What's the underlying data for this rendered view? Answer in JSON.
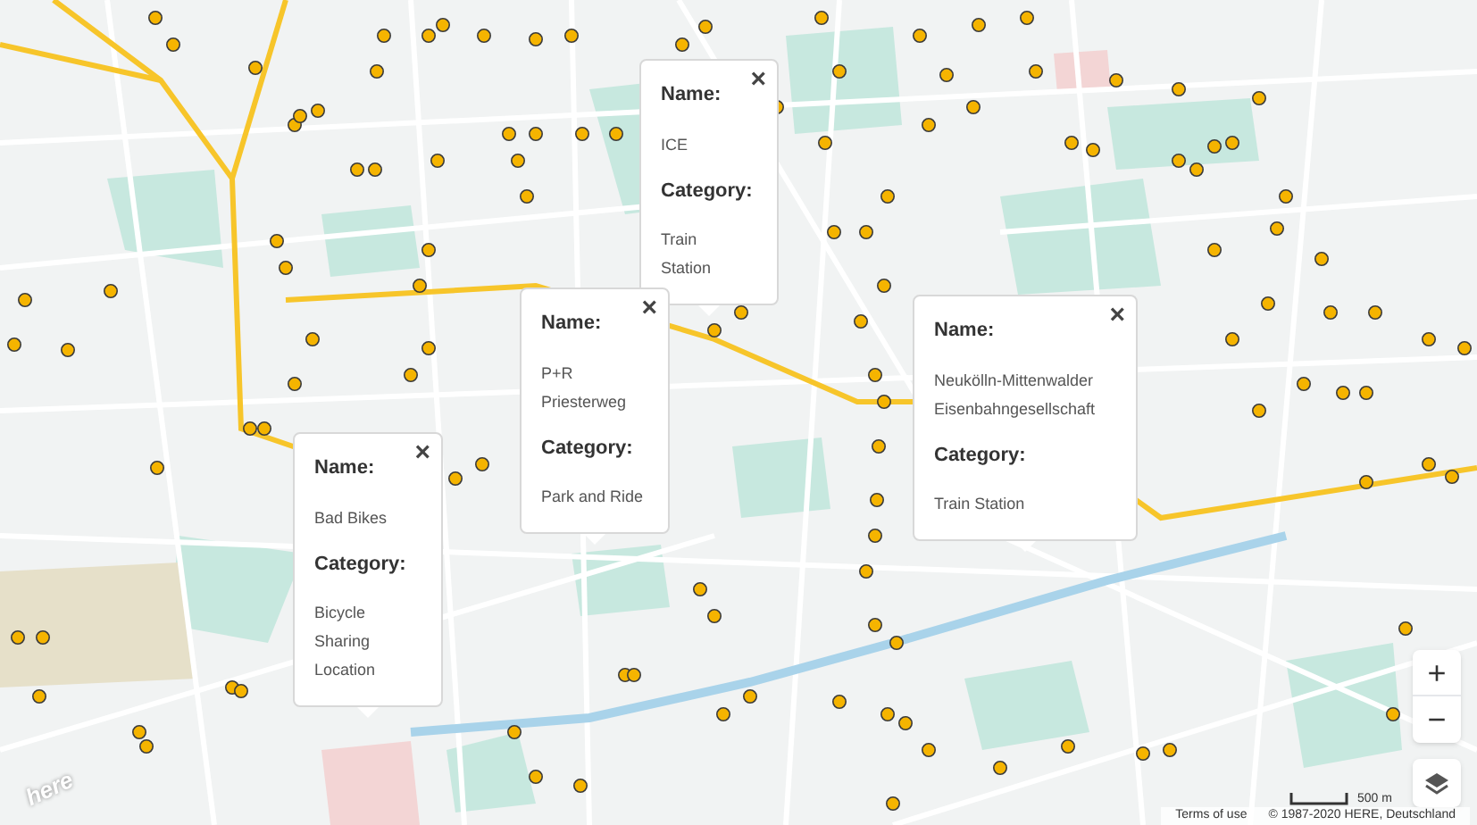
{
  "popups": [
    {
      "name_label": "Name:",
      "name": "ICE",
      "category_label": "Category:",
      "category": "Train Station",
      "close": "×"
    },
    {
      "name_label": "Name:",
      "name": "P+R Priesterweg",
      "category_label": "Category:",
      "category": "Park and Ride",
      "close": "×"
    },
    {
      "name_label": "Name:",
      "name": "Bad Bikes",
      "category_label": "Category:",
      "category": "Bicycle Sharing Location",
      "close": "×"
    },
    {
      "name_label": "Name:",
      "name": "Neukölln-Mittenwalder Eisenbahngesellschaft",
      "category_label": "Category:",
      "category": "Train Station",
      "close": "×"
    }
  ],
  "zoom_in": "+",
  "zoom_out": "−",
  "logo": "here",
  "scale": "500 m",
  "attribution": {
    "terms": "Terms of use",
    "copyright": "© 1987-2020 HERE, Deutschland"
  }
}
